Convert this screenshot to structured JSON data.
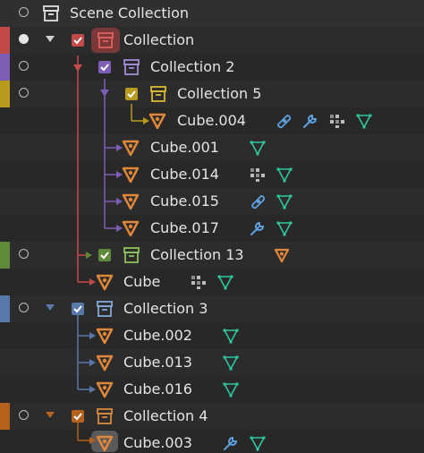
{
  "outliner": {
    "scene_label": "Scene Collection",
    "rows": [
      {
        "label": "Collection"
      },
      {
        "label": "Collection 2"
      },
      {
        "label": "Collection 5"
      },
      {
        "label": "Cube.004"
      },
      {
        "label": "Cube.001"
      },
      {
        "label": "Cube.014"
      },
      {
        "label": "Cube.015"
      },
      {
        "label": "Cube.017"
      },
      {
        "label": "Collection 13"
      },
      {
        "label": "Cube"
      },
      {
        "label": "Collection 3"
      },
      {
        "label": "Cube.002"
      },
      {
        "label": "Cube.013"
      },
      {
        "label": "Cube.016"
      },
      {
        "label": "Collection 4"
      },
      {
        "label": "Cube.003"
      }
    ]
  },
  "colors": {
    "red": "#c44a4a",
    "purple": "#7c5fb4",
    "yellow": "#b89a1c",
    "green": "#5e8a3a",
    "blue": "#5778a8",
    "orange": "#b3611b",
    "object": "#e0873a",
    "data_teal": "#2fc7a0",
    "modifier_blue": "#5ea0e0"
  }
}
